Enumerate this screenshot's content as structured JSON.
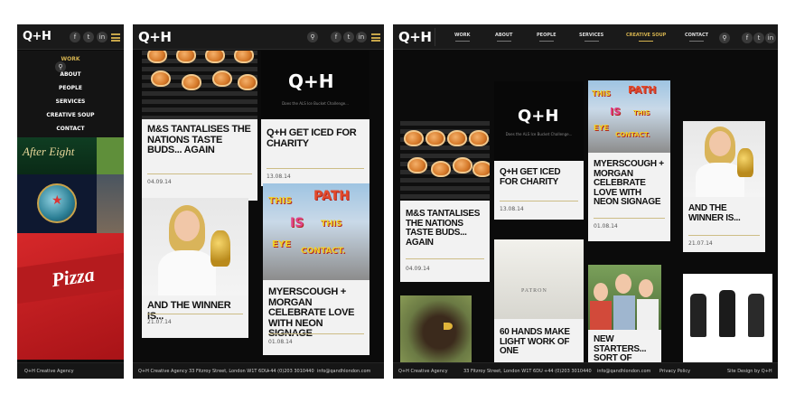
{
  "brand": {
    "logo": "Q+H"
  },
  "social": [
    "f",
    "t",
    "in"
  ],
  "nav": {
    "items": [
      "WORK",
      "ABOUT",
      "PEOPLE",
      "SERVICES",
      "CREATIVE SOUP",
      "CONTACT"
    ],
    "active_mobile": "WORK",
    "active_desktop": "CREATIVE SOUP"
  },
  "mobile_tiles": {
    "after_eight": "After Eight",
    "pizza": "Pizza"
  },
  "posts": {
    "mgs": {
      "title": "M&S TANTALISES THE NATIONS TASTE BUDS... AGAIN",
      "date": "04.09.14"
    },
    "iced": {
      "title": "Q+H GET ICED FOR CHARITY",
      "date": "13.08.14",
      "image_logo": "Q+H",
      "image_caption": "Does the ALS Ice Bucket Challenge..."
    },
    "winner": {
      "title": "AND THE WINNER IS...",
      "date": "21.07.14"
    },
    "myerscough": {
      "title": "MYERSCOUGH + MORGAN CELEBRATE LOVE WITH NEON SIGNAGE",
      "date": "01.08.14",
      "neon_words": [
        "THIS",
        "PATH",
        "IS",
        "THIS",
        "EYE",
        "CONTACT."
      ]
    },
    "hands": {
      "title": "60 HANDS MAKE LIGHT WORK OF ONE",
      "image_text": "PATRON"
    },
    "starters": {
      "title": "NEW STARTERS... SORT OF"
    }
  },
  "footer": {
    "agency": "Q+H Creative Agency",
    "address": "33 Fitzroy Street, London W1T 6DU",
    "phone": "+44 (0)203 3010440",
    "email": "info@qandhlondon.com",
    "privacy": "Privacy Policy",
    "credit": "Site Design by Q+H"
  },
  "colors": {
    "accent": "#d4b24f",
    "background": "#0b0b0b",
    "card": "#f2f2f2",
    "bar": "#1a1a1a"
  }
}
